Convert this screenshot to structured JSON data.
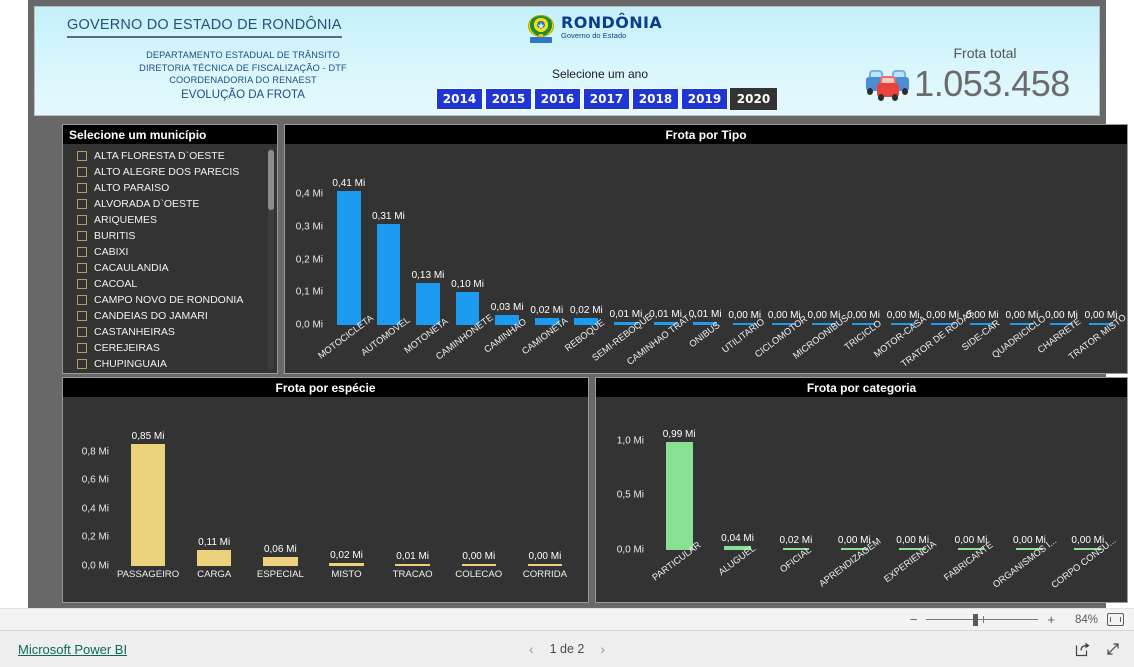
{
  "header": {
    "gov_title": "GOVERNO DO ESTADO DE RONDÔNIA",
    "dept_line1": "DEPARTAMENTO ESTADUAL DE TRÂNSITO",
    "dept_line2": "DIRETORIA TÉCNICA DE FISCALIZAÇÃO  - DTF",
    "dept_line3": "COORDENADORIA DO RENAEST",
    "subtitle": "EVOLUÇÃO DA FROTA",
    "logo_name": "RONDÔNIA",
    "logo_sub": "Governo do Estado",
    "year_label": "Selecione um ano",
    "years": [
      "2014",
      "2015",
      "2016",
      "2017",
      "2018",
      "2019",
      "2020"
    ],
    "selected_year": "2020",
    "total_label": "Frota total",
    "total_value": "1.053.458",
    "accent_blue": "#1f35d4",
    "selected_bg": "#333333"
  },
  "slicer": {
    "title": "Selecione um município",
    "items": [
      {
        "label": "ALTA FLORESTA D`OESTE",
        "checked": false
      },
      {
        "label": "ALTO ALEGRE DOS PARECIS",
        "checked": false
      },
      {
        "label": "ALTO PARAISO",
        "checked": false
      },
      {
        "label": "ALVORADA D`OESTE",
        "checked": false
      },
      {
        "label": "ARIQUEMES",
        "checked": false
      },
      {
        "label": "BURITIS",
        "checked": false
      },
      {
        "label": "CABIXI",
        "checked": false
      },
      {
        "label": "CACAULANDIA",
        "checked": false
      },
      {
        "label": "CACOAL",
        "checked": false
      },
      {
        "label": "CAMPO NOVO DE RONDONIA",
        "checked": false
      },
      {
        "label": "CANDEIAS DO JAMARI",
        "checked": false
      },
      {
        "label": "CASTANHEIRAS",
        "checked": false
      },
      {
        "label": "CEREJEIRAS",
        "checked": false
      },
      {
        "label": "CHUPINGUAIA",
        "checked": false
      }
    ]
  },
  "chart_data": [
    {
      "type": "bar",
      "title": "Frota por Tipo",
      "color": "#1d9bf0",
      "xlabel": "",
      "ylabel": "",
      "ylim": [
        0,
        0.45
      ],
      "yticks": [
        "0,0 Mi",
        "0,1 Mi",
        "0,2 Mi",
        "0,3 Mi",
        "0,4 Mi"
      ],
      "ytick_values": [
        0.0,
        0.1,
        0.2,
        0.3,
        0.4
      ],
      "grid": false,
      "label_rotation": -37,
      "categories": [
        "MOTOCICLETA",
        "AUTOMOVEL",
        "MOTONETA",
        "CAMINHONETE",
        "CAMINHAO",
        "CAMIONETA",
        "REBOQUE",
        "SEMI-REBOQUE",
        "CAMINHAO TRAT...",
        "ONIBUS",
        "UTILITARIO",
        "CICLOMOTOR",
        "MICROONIBUS",
        "TRICICLO",
        "MOTOR-CASA",
        "TRATOR DE RODAS",
        "SIDE-CAR",
        "QUADRICICLO",
        "CHARRETE",
        "TRATOR MISTO"
      ],
      "values": [
        0.41,
        0.31,
        0.13,
        0.1,
        0.03,
        0.02,
        0.02,
        0.01,
        0.01,
        0.01,
        0.005,
        0.003,
        0.002,
        0.001,
        0.001,
        0.001,
        0.0005,
        0.0005,
        0.0003,
        0.0002
      ],
      "data_labels": [
        "0,41 Mi",
        "0,31 Mi",
        "0,13 Mi",
        "0,10 Mi",
        "0,03 Mi",
        "0,02 Mi",
        "0,02 Mi",
        "0,01 Mi",
        "0,01 Mi",
        "0,01 Mi",
        "0,00 Mi",
        "0,00 Mi",
        "0,00 Mi",
        "0,00 Mi",
        "0,00 Mi",
        "0,00 Mi",
        "0,00 Mi",
        "0,00 Mi",
        "0,00 Mi",
        "0,00 Mi"
      ]
    },
    {
      "type": "bar",
      "title": "Frota por espécie",
      "color": "#e9d27a",
      "xlabel": "",
      "ylabel": "",
      "ylim": [
        0,
        0.93
      ],
      "yticks": [
        "0,0 Mi",
        "0,2 Mi",
        "0,4 Mi",
        "0,6 Mi",
        "0,8 Mi"
      ],
      "ytick_values": [
        0.0,
        0.2,
        0.4,
        0.6,
        0.8
      ],
      "grid": false,
      "label_rotation": 0,
      "categories": [
        "PASSAGEIRO",
        "CARGA",
        "ESPECIAL",
        "MISTO",
        "TRACAO",
        "COLECAO",
        "CORRIDA"
      ],
      "values": [
        0.85,
        0.11,
        0.06,
        0.02,
        0.01,
        0.001,
        0.0005
      ],
      "data_labels": [
        "0,85 Mi",
        "0,11 Mi",
        "0,06 Mi",
        "0,02 Mi",
        "0,01 Mi",
        "0,00 Mi",
        "0,00 Mi"
      ]
    },
    {
      "type": "bar",
      "title": "Frota por categoria",
      "color": "#87e093",
      "xlabel": "",
      "ylabel": "",
      "ylim": [
        0,
        1.09
      ],
      "yticks": [
        "0,0 Mi",
        "0,5 Mi",
        "1,0 Mi"
      ],
      "ytick_values": [
        0.0,
        0.5,
        1.0
      ],
      "grid": false,
      "label_rotation": -37,
      "categories": [
        "PARTICULAR",
        "ALUGUEL",
        "OFICIAL",
        "APRENDIZAGEM",
        "EXPERIENCIA",
        "FABRICANTE",
        "ORGANISMOS I...",
        "CORPO CONSU..."
      ],
      "values": [
        0.99,
        0.04,
        0.02,
        0.002,
        0.001,
        0.001,
        0.0005,
        0.0003
      ],
      "data_labels": [
        "0,99 Mi",
        "0,04 Mi",
        "0,02 Mi",
        "0,00 Mi",
        "0,00 Mi",
        "0,00 Mi",
        "0,00 Mi",
        "0,00 Mi"
      ]
    }
  ],
  "zoombar": {
    "minus": "−",
    "plus": "+",
    "percent": "84%"
  },
  "statusbar": {
    "brand": "Microsoft Power BI",
    "page": "1 de 2",
    "prev": "‹",
    "next": "›"
  }
}
